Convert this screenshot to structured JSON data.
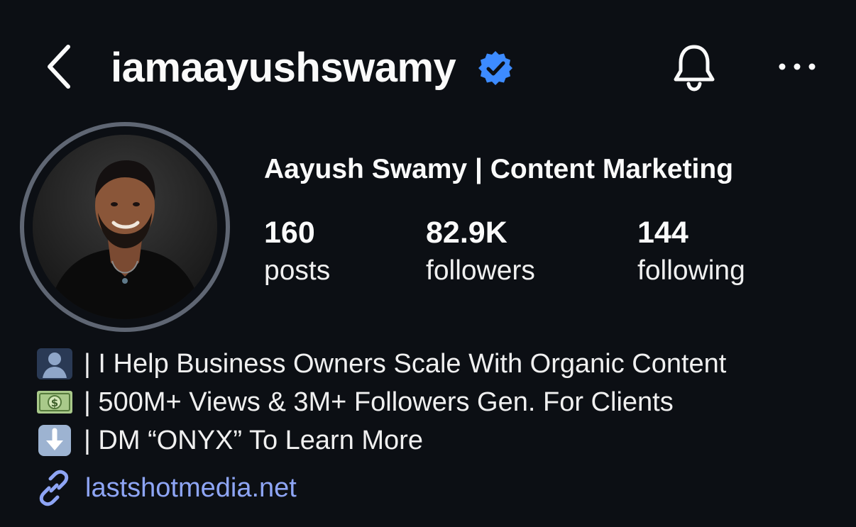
{
  "header": {
    "username": "iamaayushswamy",
    "back_icon": "chevron-left-icon",
    "verified_icon": "verified-badge-icon",
    "bell_icon": "bell-icon",
    "more_icon": "more-horizontal-icon"
  },
  "profile": {
    "display_name": "Aayush Swamy | Content Marketing",
    "stats": {
      "posts": {
        "value": "160",
        "label": "posts"
      },
      "followers": {
        "value": "82.9K",
        "label": "followers"
      },
      "following": {
        "value": "144",
        "label": "following"
      }
    }
  },
  "bio": {
    "lines": [
      {
        "icon": "person-silhouette-icon",
        "text": "| I Help Business Owners Scale With Organic Content"
      },
      {
        "icon": "money-banknote-icon",
        "text": "| 500M+ Views & 3M+ Followers Gen. For Clients"
      },
      {
        "icon": "down-arrow-icon",
        "text": "| DM “ONYX” To Learn More"
      }
    ],
    "link": {
      "icon": "link-icon",
      "text": "lastshotmedia.net"
    }
  },
  "colors": {
    "background": "#0c0f14",
    "text": "#fafafa",
    "verified": "#3d8bff",
    "link": "#8ea5f5",
    "avatar_ring": "#5f6673"
  }
}
